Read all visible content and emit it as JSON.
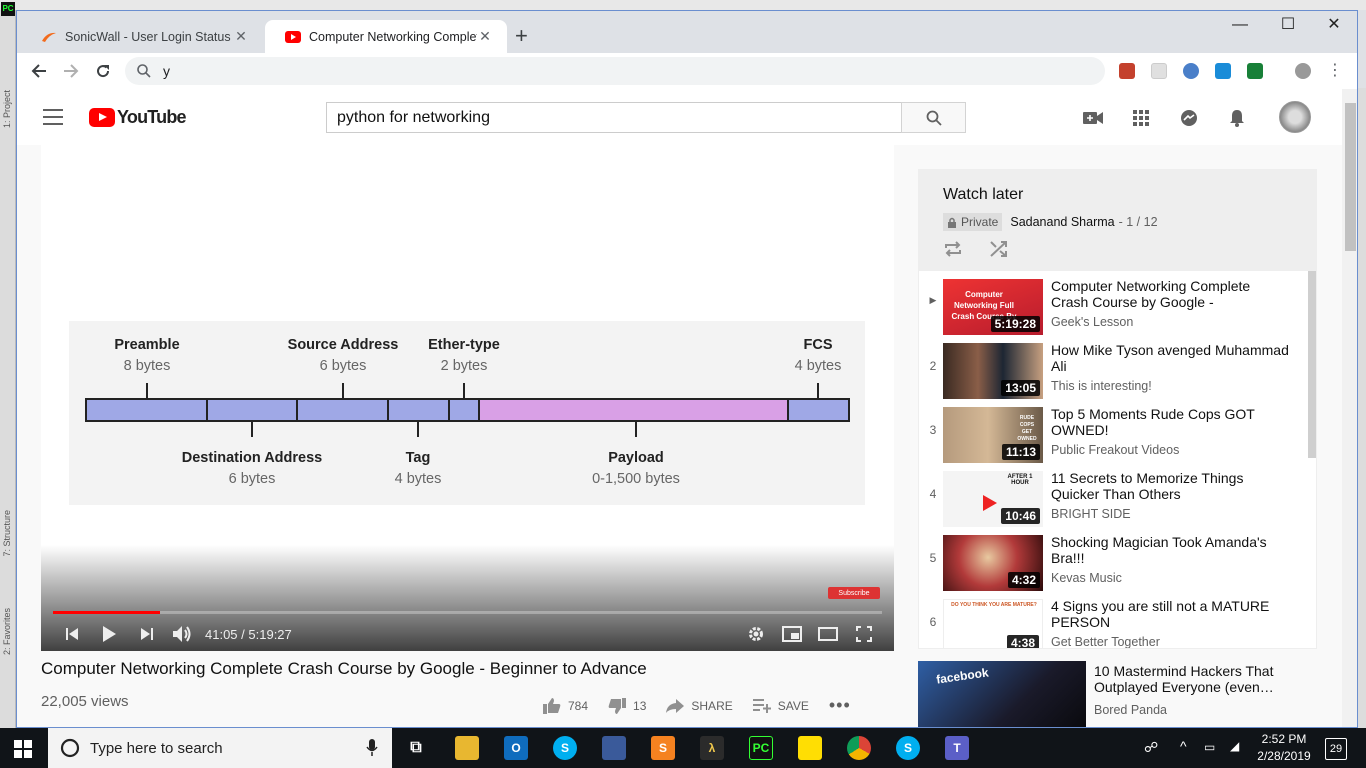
{
  "browser": {
    "tabs": [
      {
        "title": "SonicWall - User Login Status",
        "active": false
      },
      {
        "title": "Computer Networking Complete",
        "active": true
      }
    ],
    "address": "y"
  },
  "youtube": {
    "search_query": "python for networking",
    "video": {
      "title": "Computer Networking Complete Crash Course by Google - Beginner to Advance",
      "views": "22,005 views",
      "likes": "784",
      "dislikes": "13",
      "share_label": "SHARE",
      "save_label": "SAVE",
      "time_current": "41:05",
      "time_separator": " / ",
      "time_total": "5:19:27",
      "progress_fraction": 0.1286,
      "subscribe_watermark": "Subscribe",
      "frame": {
        "top_fields": [
          {
            "name": "Preamble",
            "size": "8 bytes"
          },
          {
            "name": "Source Address",
            "size": "6 bytes"
          },
          {
            "name": "Ether-type",
            "size": "2 bytes"
          },
          {
            "name": "FCS",
            "size": "4 bytes"
          }
        ],
        "bottom_fields": [
          {
            "name": "Destination Address",
            "size": "6 bytes"
          },
          {
            "name": "Tag",
            "size": "4 bytes"
          },
          {
            "name": "Payload",
            "size": "0-1,500 bytes"
          }
        ]
      }
    },
    "playlist": {
      "title": "Watch later",
      "privacy": "Private",
      "owner": "Sadanand Sharma",
      "position": "- 1 / 12",
      "items": [
        {
          "index": "▶",
          "title": "Computer Networking Complete Crash Course by Google -",
          "channel": "Geek's Lesson",
          "duration": "5:19:28",
          "thumb_text": "Computer Networking Full Crash Course By"
        },
        {
          "index": "2",
          "title": "How Mike Tyson avenged Muhammad Ali",
          "channel": "This is interesting!",
          "duration": "13:05"
        },
        {
          "index": "3",
          "title": "Top 5 Moments Rude Cops GOT OWNED!",
          "channel": "Public Freakout Videos",
          "duration": "11:13",
          "thumb_text": "RUDE COPS GET OWNED"
        },
        {
          "index": "4",
          "title": "11 Secrets to Memorize Things Quicker Than Others",
          "channel": "BRIGHT SIDE",
          "duration": "10:46",
          "thumb_text": "AFTER 1 HOUR"
        },
        {
          "index": "5",
          "title": "Shocking Magician Took Amanda's Bra!!!",
          "channel": "Kevas Music",
          "duration": "4:32"
        },
        {
          "index": "6",
          "title": "4 Signs you are still not a MATURE PERSON",
          "channel": "Get Better Together",
          "duration": "4:38",
          "thumb_text": "DO YOU THINK YOU ARE MATURE?"
        }
      ]
    },
    "recommended": {
      "title": "10 Mastermind Hackers That Outplayed Everyone (even…",
      "channel": "Bored Panda",
      "thumb_text": "facebook"
    }
  },
  "taskbar": {
    "search_placeholder": "Type here to search",
    "time": "2:52 PM",
    "date": "2/28/2019",
    "notifications": "29"
  },
  "ide": {
    "left_labels": [
      "1: Project",
      "7: Structure",
      "2: Favorites"
    ]
  }
}
